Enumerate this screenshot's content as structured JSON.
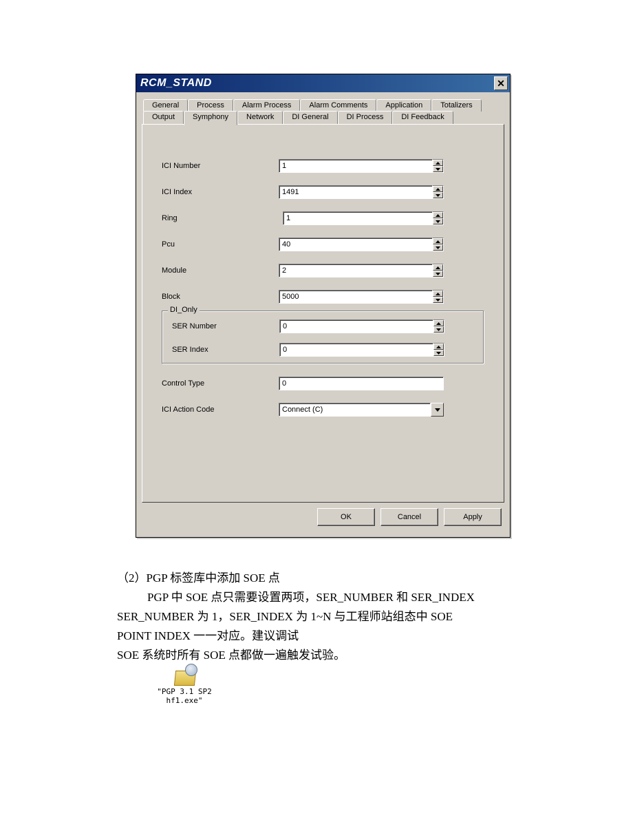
{
  "window": {
    "title": "RCM_STAND",
    "close_glyph": "✕"
  },
  "tabs": {
    "row1": [
      "General",
      "Process",
      "Alarm Process",
      "Alarm Comments",
      "Application",
      "Totalizers"
    ],
    "row2": [
      "Output",
      "Symphony",
      "Network",
      "DI General",
      "DI Process",
      "DI Feedback"
    ],
    "selected": "Symphony"
  },
  "form": {
    "ici_number": {
      "label": "ICI Number",
      "value": "1"
    },
    "ici_index": {
      "label": "ICI Index",
      "value": "1491"
    },
    "ring": {
      "label": "Ring",
      "value": "1"
    },
    "pcu": {
      "label": "Pcu",
      "value": "40"
    },
    "module": {
      "label": "Module",
      "value": "2"
    },
    "block": {
      "label": "Block",
      "value": "5000"
    },
    "di_only_legend": "DI_Only",
    "ser_number": {
      "label": "SER Number",
      "value": "0"
    },
    "ser_index": {
      "label": "SER Index",
      "value": "0"
    },
    "control_type": {
      "label": "Control Type",
      "value": "0"
    },
    "ici_action": {
      "label": "ICI Action Code",
      "value": "Connect (C)"
    }
  },
  "buttons": {
    "ok": "OK",
    "cancel": "Cancel",
    "apply": "Apply"
  },
  "doc": {
    "line1": "（2）PGP 标签库中添加 SOE 点",
    "line2": "PGP 中 SOE 点只需要设置两项，SER_NUMBER 和 SER_INDEX",
    "line3": "SER_NUMBER 为 1，SER_INDEX 为 1~N 与工程师站组态中 SOE",
    "line4": "POINT INDEX 一一对应。建议调试",
    "line5": "SOE 系统时所有 SOE 点都做一遍触发试验。",
    "fileicon_line1": "\"PGP 3.1 SP2",
    "fileicon_line2": "hf1.exe\""
  }
}
